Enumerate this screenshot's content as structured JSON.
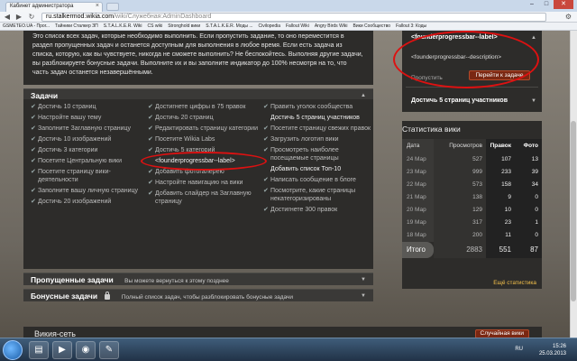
{
  "browser": {
    "tab_title": "Кабинет администратора",
    "url_host": "ru.stalkermod.wikia.com",
    "url_path": "/wiki/Служебная:AdminDashboard",
    "bookmarks": [
      "GSMETEO.UA - Прог...",
      "Тайники Сталкер ЗП",
      "S.T.A.L.K.E.R. Wiki",
      "CS wiki",
      "Stronghold вики",
      "S.T.A.L.K.E.R. Моды ...",
      "Civilopedia",
      "Fallout Wiki",
      "Angry Birds Wiki",
      "Вики Сообщество",
      "Fallout 3: Коды"
    ]
  },
  "intro": {
    "text": "Это список всех задач, которые необходимо выполнить. Если пропустить задание, то оно переместится в раздел пропущенных задач и останется доступным для выполнения в любое время. Если есть задача из списка, которую, как вы чувствуете, никогда не сможете выполнить? Не беспокойтесь. Выполняя другие задачи, вы разблокируете бонусные задачи. Выполните их и вы заполните индикатор до 100% несмотря на то, что часть задач останется незавершёнными."
  },
  "tasks": {
    "header": "Задачи",
    "col1": [
      {
        "label": "Достичь 10 страниц",
        "done": false
      },
      {
        "label": "Настройте вашу тему",
        "done": false
      },
      {
        "label": "Заполните Заглавную страницу",
        "done": false
      },
      {
        "label": "Достичь 10 изображений",
        "done": false
      },
      {
        "label": "Достичь 3 категории",
        "done": false
      },
      {
        "label": "Посетите Центральную вики",
        "done": false
      },
      {
        "label": "Посетите страницу вики-деятельности",
        "done": false
      },
      {
        "label": "Заполните вашу личную страницу",
        "done": false
      },
      {
        "label": "Достичь 20 изображений",
        "done": false
      }
    ],
    "col2": [
      {
        "label": "Достигнете цифры в 75 правок",
        "done": false
      },
      {
        "label": "Достичь 20 страниц",
        "done": false
      },
      {
        "label": "Редактировать страницу категории",
        "done": false
      },
      {
        "label": "Посетите Wikia Labs",
        "done": false
      },
      {
        "label": "Достичь 5 категорий",
        "done": false
      },
      {
        "label": "<founderprogressbar--label>",
        "done": true
      },
      {
        "label": "Добавить фотогалерею",
        "done": false
      },
      {
        "label": "Настройте навигацию на вики",
        "done": false
      },
      {
        "label": "Добавить слайдер на Заглавную страницу",
        "done": false
      }
    ],
    "col3": [
      {
        "label": "Править уголок сообщества",
        "done": false
      },
      {
        "label": "Достичь 5 страниц участников",
        "done": true
      },
      {
        "label": "Посетите страницу свежих правок",
        "done": false
      },
      {
        "label": "Загрузить логотип вики",
        "done": false
      },
      {
        "label": "Просмотреть наиболее посещаемые страницы",
        "done": false
      },
      {
        "label": "Добавить список Топ-10",
        "done": true
      },
      {
        "label": "Написать сообщение в блоге",
        "done": false
      },
      {
        "label": "Посмотрите, какие страницы некатегоризированы",
        "done": false
      },
      {
        "label": "Достигнете 300 правок",
        "done": false
      }
    ]
  },
  "skipped": {
    "title": "Пропущенные задачи",
    "desc": "Вы можете вернуться к этому позднее"
  },
  "bonus": {
    "title": "Бонусные задачи",
    "desc": "Полный список задач, чтобы разблокировать бонусные задачи"
  },
  "founder": {
    "label": "<founderprogressbar--label>",
    "description": "<founderprogressbar--description>",
    "skip": "Пропустить",
    "go": "Перейти к задаче",
    "next": "Достичь 5 страниц участников"
  },
  "stats": {
    "title": "Статистика вики",
    "headers": [
      "Дата",
      "Просмотров",
      "Правок",
      "Фото"
    ],
    "rows": [
      [
        "24 Мар",
        "527",
        "107",
        "13"
      ],
      [
        "23 Мар",
        "999",
        "233",
        "39"
      ],
      [
        "22 Мар",
        "573",
        "158",
        "34"
      ],
      [
        "21 Мар",
        "138",
        "9",
        "0"
      ],
      [
        "20 Мар",
        "129",
        "10",
        "0"
      ],
      [
        "19 Мар",
        "317",
        "23",
        "1"
      ],
      [
        "18 Мар",
        "200",
        "11",
        "0"
      ]
    ],
    "total_label": "Итого",
    "total": [
      "2883",
      "551",
      "87"
    ],
    "more": "Ещё статистика"
  },
  "footer": {
    "wikinet": "Викия-сеть",
    "random": "Случайная вики"
  },
  "taskbar": {
    "lang": "RU",
    "time": "15:26",
    "date": "25.03.2013"
  }
}
